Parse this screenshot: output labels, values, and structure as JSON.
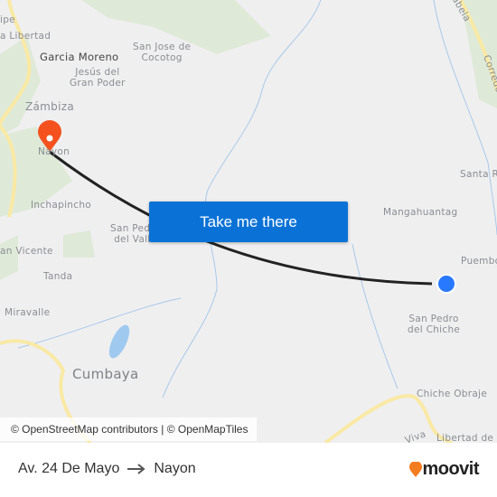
{
  "map": {
    "labels": {
      "felipe": "ipe",
      "la_libertad": "a Libertad",
      "garcia_moreno": "Garcia Moreno",
      "san_jose": "San Jose de\nCocotog",
      "jesus": "Jesús del\nGran Poder",
      "zambiza": "Zámbiza",
      "nayon": "Nayon",
      "inchapincho": "Inchapincho",
      "san_pedro_valle": "San Pedro\ndel Valle",
      "san_vicente": "an Vicente",
      "tanda": "Tanda",
      "miravalle": "Miravalle",
      "cumbaya": "Cumbaya",
      "mangahuantag": "Mangahuantag",
      "santa_rosa": "Santa R",
      "puembo": "Puembo",
      "san_pedro_chiche": "San Pedro\ndel Chiche",
      "chiche_obraje": "Chiche Obraje",
      "libertad_de": "Libertad de",
      "isabela": "abela",
      "corredor": "Corredor",
      "viva": "Viva"
    },
    "origin_marker_color": "#2979ff",
    "destination_marker_color": "#f4511e",
    "route_color": "#222222",
    "cta_label": "Take me there",
    "attribution": "© OpenStreetMap contributors | © OpenMapTiles"
  },
  "footer": {
    "origin": "Av. 24 De Mayo",
    "arrow_icon": "arrow-right-icon",
    "destination": "Nayon",
    "brand": "moovit"
  }
}
